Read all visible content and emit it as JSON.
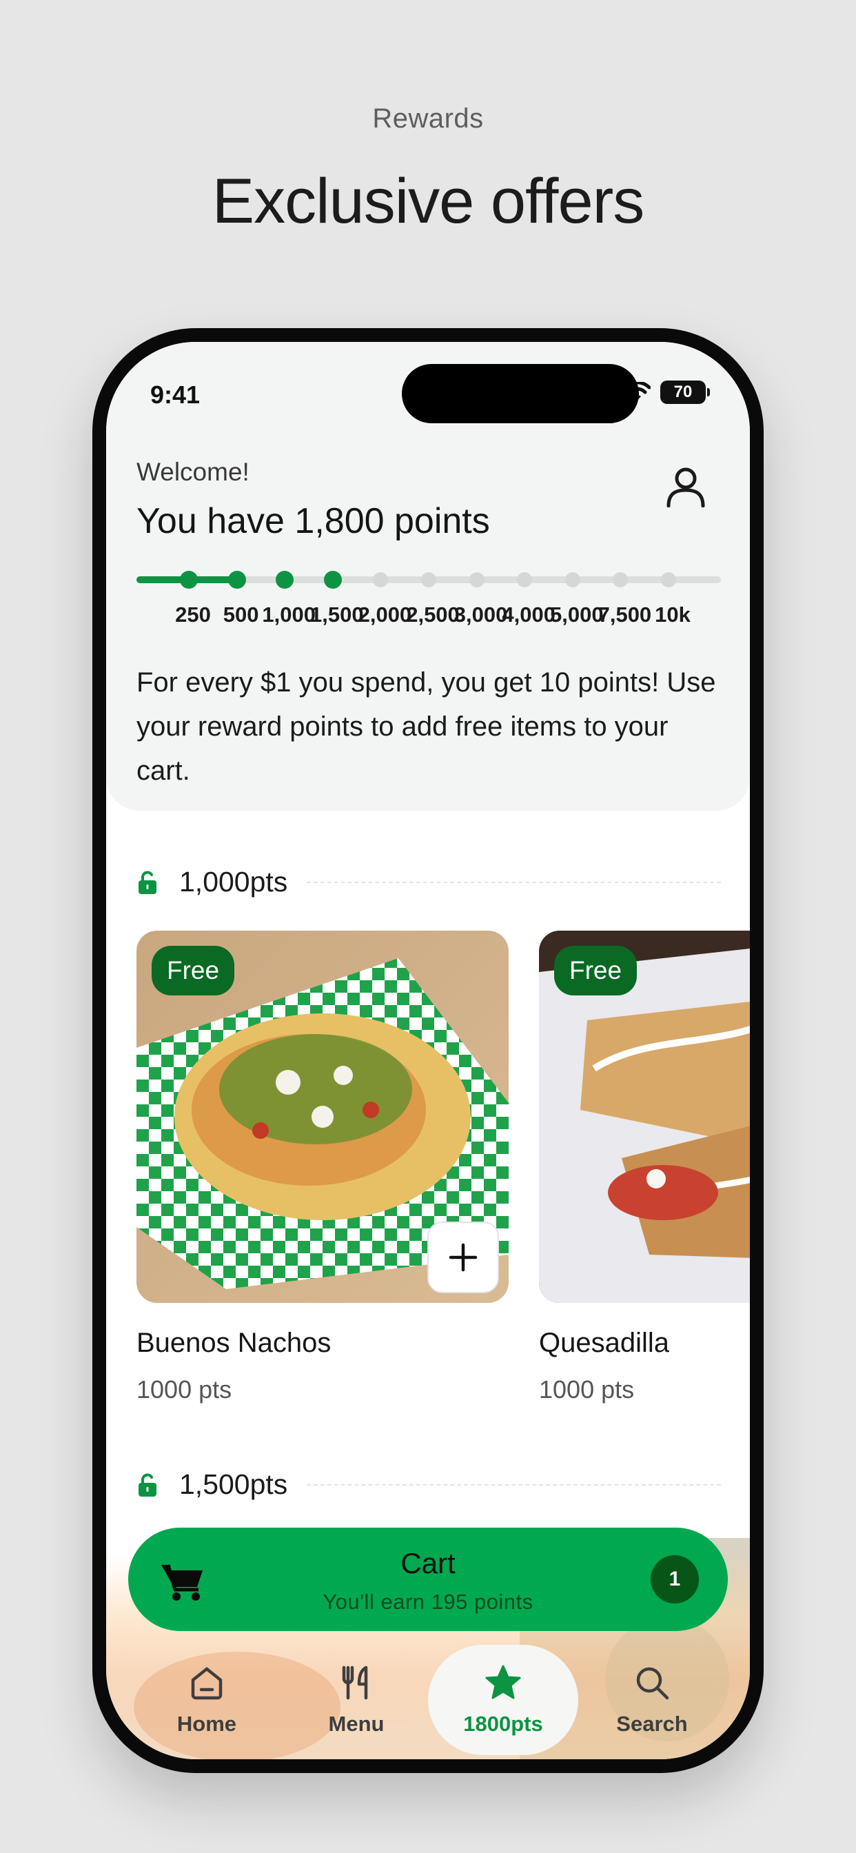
{
  "marketing": {
    "eyebrow": "Rewards",
    "headline": "Exclusive offers"
  },
  "status_bar": {
    "time": "9:41",
    "battery": "70"
  },
  "header": {
    "welcome": "Welcome!",
    "points_title": "You have 1,800 points",
    "profile_icon": "person-icon",
    "progress": {
      "current_points": 1800,
      "milestones": [
        "250",
        "500",
        "1,000",
        "1,500",
        "2,000",
        "2,500",
        "3,000",
        "4,000",
        "5,000",
        "7,500",
        "10k"
      ]
    },
    "intro": "For every $1 you spend, you get 10 points! Use your reward points to add free items to your cart."
  },
  "tiers": [
    {
      "label": "1,000pts",
      "icon": "unlock-icon",
      "items": [
        {
          "badge": "Free",
          "name": "Buenos Nachos",
          "points": "1000 pts"
        },
        {
          "badge": "Free",
          "name": "Quesadilla",
          "points": "1000 pts"
        }
      ]
    },
    {
      "label": "1,500pts",
      "icon": "unlock-icon",
      "items": []
    }
  ],
  "cart": {
    "title": "Cart",
    "subtitle": "You'll earn 195 points",
    "count": "1",
    "icon": "cart-icon"
  },
  "nav": [
    {
      "label": "Home",
      "icon": "home-icon",
      "active": false
    },
    {
      "label": "Menu",
      "icon": "utensils-icon",
      "active": false
    },
    {
      "label": "1800pts",
      "icon": "star-icon",
      "active": true
    },
    {
      "label": "Search",
      "icon": "search-icon",
      "active": false
    }
  ],
  "colors": {
    "brand_green": "#00a84f",
    "dark_green": "#0a6a23",
    "progress_green": "#0c9443",
    "background": "#e6e6e6"
  }
}
